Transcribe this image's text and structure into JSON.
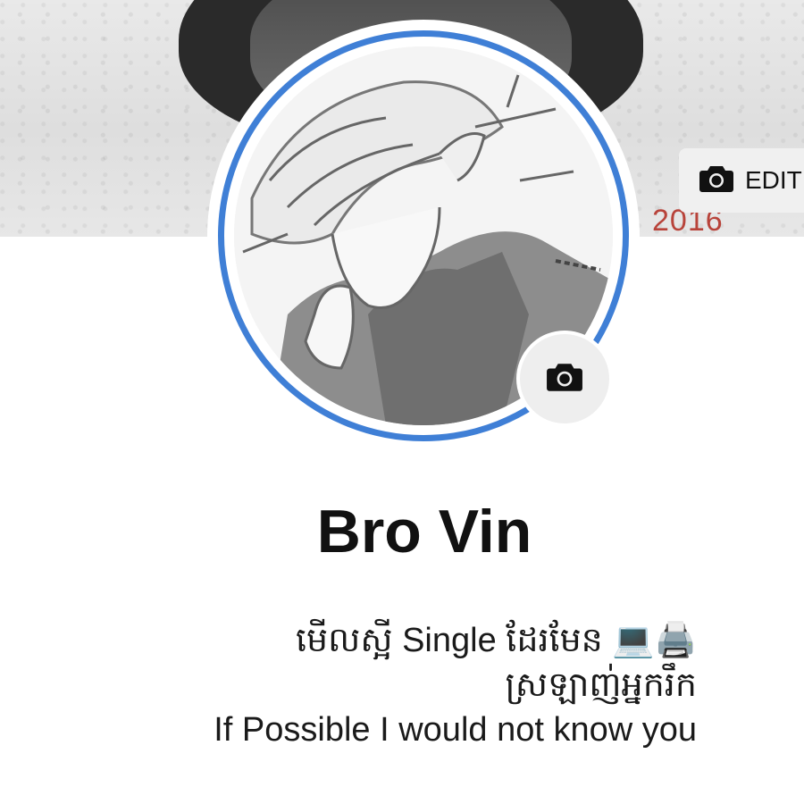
{
  "cover": {
    "year_text": "2016",
    "edit_label": "EDIT",
    "edit_icon": "camera-icon"
  },
  "profile": {
    "ring_color": "#3f7fd6",
    "camera_icon": "camera-icon",
    "name": "Bro Vin",
    "bio": {
      "line1": "មើលស្អី Single ដែរមែន 💻🖨️",
      "line2": "ស្រឡាញ់អ្នករឹក",
      "line3": "If Possible I would not know you"
    }
  }
}
